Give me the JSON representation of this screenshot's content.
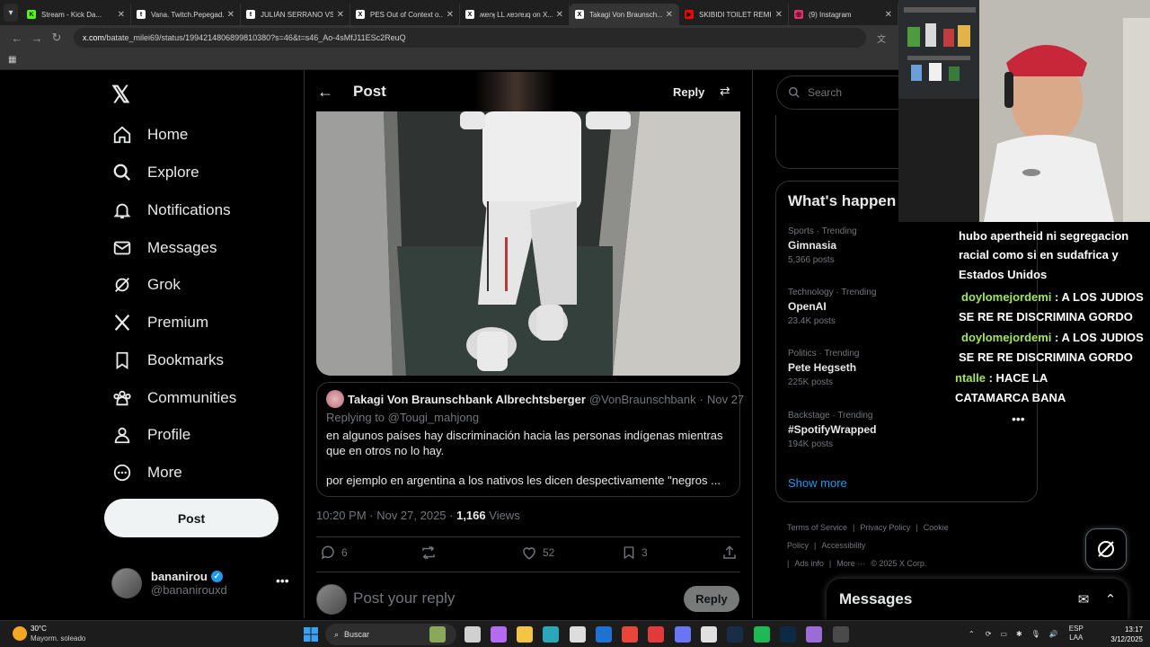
{
  "browser": {
    "tabs": [
      {
        "label": "Stream - Kick Da...",
        "icon_color": "#53fc18",
        "icon_letter": "K"
      },
      {
        "label": "Vana. Twitch.Pepegad...",
        "icon_color": "#ffffff",
        "icon_letter": "t"
      },
      {
        "label": "JULIÁN SERRANO VS...",
        "icon_color": "#ffffff",
        "icon_letter": "t"
      },
      {
        "label": "PES Out of Context o...",
        "icon_color": "#ffffff",
        "icon_letter": "X"
      },
      {
        "label": "ʍɐɾʞ LL ʌɐɔɾɐɹq on X...",
        "icon_color": "#ffffff",
        "icon_letter": "X"
      },
      {
        "label": "Takagi Von Braunsch...",
        "icon_color": "#ffffff",
        "icon_letter": "X"
      },
      {
        "label": "SKIBIDI TOILET REMI...",
        "icon_color": "#ff0000",
        "icon_letter": "▶"
      },
      {
        "label": "(9) Instagram",
        "icon_color": "#e1306c",
        "icon_letter": "◎"
      }
    ],
    "url_host": "x.com",
    "url_path": "/batate_milei69/status/1994214806899810380?s=46&t=s46_Ao-4sMfJ11ESc2ReuQ"
  },
  "sidebar": {
    "items": [
      {
        "label": "Home",
        "icon": "home-icon"
      },
      {
        "label": "Explore",
        "icon": "search-icon"
      },
      {
        "label": "Notifications",
        "icon": "bell-icon"
      },
      {
        "label": "Messages",
        "icon": "mail-icon"
      },
      {
        "label": "Grok",
        "icon": "grok-icon"
      },
      {
        "label": "Premium",
        "icon": "x-icon"
      },
      {
        "label": "Bookmarks",
        "icon": "bookmark-icon"
      },
      {
        "label": "Communities",
        "icon": "communities-icon"
      },
      {
        "label": "Profile",
        "icon": "profile-icon"
      },
      {
        "label": "More",
        "icon": "more-circle-icon"
      }
    ],
    "post_button": "Post",
    "account": {
      "name": "bananirou",
      "handle": "@bananirouxd"
    }
  },
  "header": {
    "title": "Post",
    "reply": "Reply"
  },
  "quote": {
    "name": "Takagi Von Braunschbank Albrechtsberger",
    "handle": "@VonBraunschbank",
    "date": "Nov 27",
    "replying_prefix": "Replying to",
    "replying_handle": "@Tougi_mahjong",
    "text1": "en algunos países hay discriminación hacia las personas indígenas mientras que en otros no lo hay.",
    "text2": "por ejemplo en argentina a los nativos les dicen despectivamente \"negros ..."
  },
  "meta": {
    "time": "10:20 PM · Nov 27, 2025 · ",
    "views_count": "1,166",
    "views_label": " Views"
  },
  "actions": {
    "replies": "6",
    "likes": "52",
    "bookmarks": "3"
  },
  "reply_box": {
    "placeholder": "Post your reply",
    "button": "Reply"
  },
  "right": {
    "search_placeholder": "Search",
    "trends_title": "What's happen",
    "trends": [
      {
        "category": "Sports · Trending",
        "name": "Gimnasia",
        "count": "5,366 posts"
      },
      {
        "category": "Technology · Trending",
        "name": "OpenAI",
        "count": "23.4K posts"
      },
      {
        "category": "Politics · Trending",
        "name": "Pete Hegseth",
        "count": "225K posts"
      },
      {
        "category": "Backstage · Trending",
        "name": "#SpotifyWrapped",
        "count": "194K posts"
      }
    ],
    "show_more": "Show more",
    "footer": [
      "Terms of Service",
      "|",
      "Privacy Policy",
      "|",
      "Cookie Policy",
      "|",
      "Accessibility",
      "|",
      "Ads info",
      "|",
      "More ···",
      "© 2025 X Corp."
    ],
    "messages_title": "Messages"
  },
  "chat": {
    "lines": [
      {
        "user": "",
        "text": "hubo aperthеid ni segregacion"
      },
      {
        "user": "",
        "text": "racial como si en sudafrica y"
      },
      {
        "user": "",
        "text": "Estados Unidos"
      },
      {
        "user": "doylomejordemi",
        "text": " : A LOS JUDIOS"
      },
      {
        "user": "",
        "text": "SE RE RE DISCRIMINA GORDO"
      },
      {
        "user": "doylomejordemi",
        "text": " : A LOS JUDIOS"
      },
      {
        "user": "",
        "text": "SE RE RE DISCRIMINA GORDO"
      },
      {
        "user": "ntalle",
        "text": " : HACE LA"
      },
      {
        "user": "",
        "text": "CATAMARCA BANA"
      }
    ]
  },
  "taskbar": {
    "temp": "30°C",
    "weather": "Mayorm. soleado",
    "search": "Buscar",
    "lang1": "ESP",
    "lang2": "LAA",
    "time": "13:17",
    "date": "3/12/2025"
  }
}
